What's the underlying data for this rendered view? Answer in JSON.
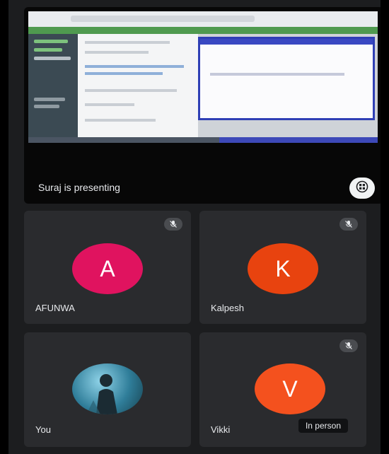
{
  "presentation": {
    "label": "Suraj is presenting",
    "layout_button": "layout-grid-icon"
  },
  "participants": [
    {
      "initial": "A",
      "name": "AFUNWA",
      "color": "#e0135f",
      "muted": true
    },
    {
      "initial": "K",
      "name": "Kalpesh",
      "color": "#e8430f",
      "muted": true
    },
    {
      "initial": "",
      "name": "You",
      "photo": true,
      "muted": false
    },
    {
      "initial": "V",
      "name": "Vikki",
      "color": "#f4511e",
      "muted": true,
      "extra_label": "In person"
    }
  ],
  "colors": {
    "background": "#1c1d1f",
    "tile": "#2a2b2e"
  }
}
